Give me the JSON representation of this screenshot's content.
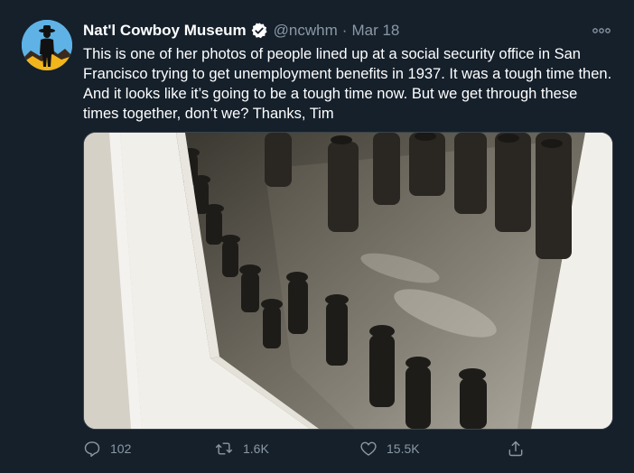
{
  "tweet": {
    "display_name": "Nat'l Cowboy Museum",
    "handle": "@ncwhm",
    "separator": "·",
    "date": "Mar 18",
    "text": "This is one of her photos of people lined up at a social security office in San Francisco trying to get unemployment benefits in 1937. It was a tough time then. And it looks like it’s going to be a tough time now. But we get through these times together, don’t we? Thanks, Tim",
    "verified": true
  },
  "actions": {
    "replies": "102",
    "retweets": "1.6K",
    "likes": "15.5K"
  },
  "icons": {
    "avatar": "cowboy-silhouette-avatar",
    "verified": "verified-badge-icon",
    "more": "more-options-icon",
    "reply": "reply-icon",
    "retweet": "retweet-icon",
    "like": "heart-icon",
    "share": "share-icon"
  },
  "colors": {
    "background": "#15202b",
    "secondary_text": "#8b98a5",
    "verified_blue": "#1da1f2"
  }
}
